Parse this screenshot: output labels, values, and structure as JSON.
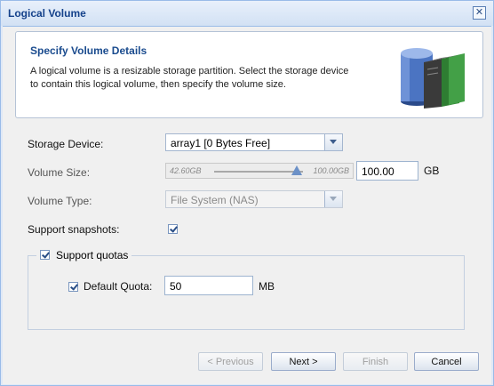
{
  "window": {
    "title": "Logical Volume"
  },
  "header": {
    "title": "Specify Volume Details",
    "description": "A logical volume is a resizable storage partition. Select the storage device to contain this logical volume, then specify the volume size."
  },
  "form": {
    "storage_device": {
      "label": "Storage Device:",
      "value": "array1 [0 Bytes Free]"
    },
    "volume_size": {
      "label": "Volume Size:",
      "slider_min": "42.60GB",
      "slider_max": "100.00GB",
      "slider_value": 0.75,
      "value": "100.00",
      "unit": "GB"
    },
    "volume_type": {
      "label": "Volume Type:",
      "value": "File System (NAS)"
    },
    "support_snapshots": {
      "label": "Support snapshots:",
      "checked": true
    },
    "support_quotas": {
      "label": "Support quotas",
      "checked": true
    },
    "default_quota": {
      "label": "Default Quota:",
      "value": "50",
      "unit": "MB",
      "checked": true
    }
  },
  "buttons": {
    "previous": "< Previous",
    "next": "Next >",
    "finish": "Finish",
    "cancel": "Cancel"
  },
  "icons": {
    "close": "close-icon",
    "header_graphic": "storage-volumes-icon"
  }
}
